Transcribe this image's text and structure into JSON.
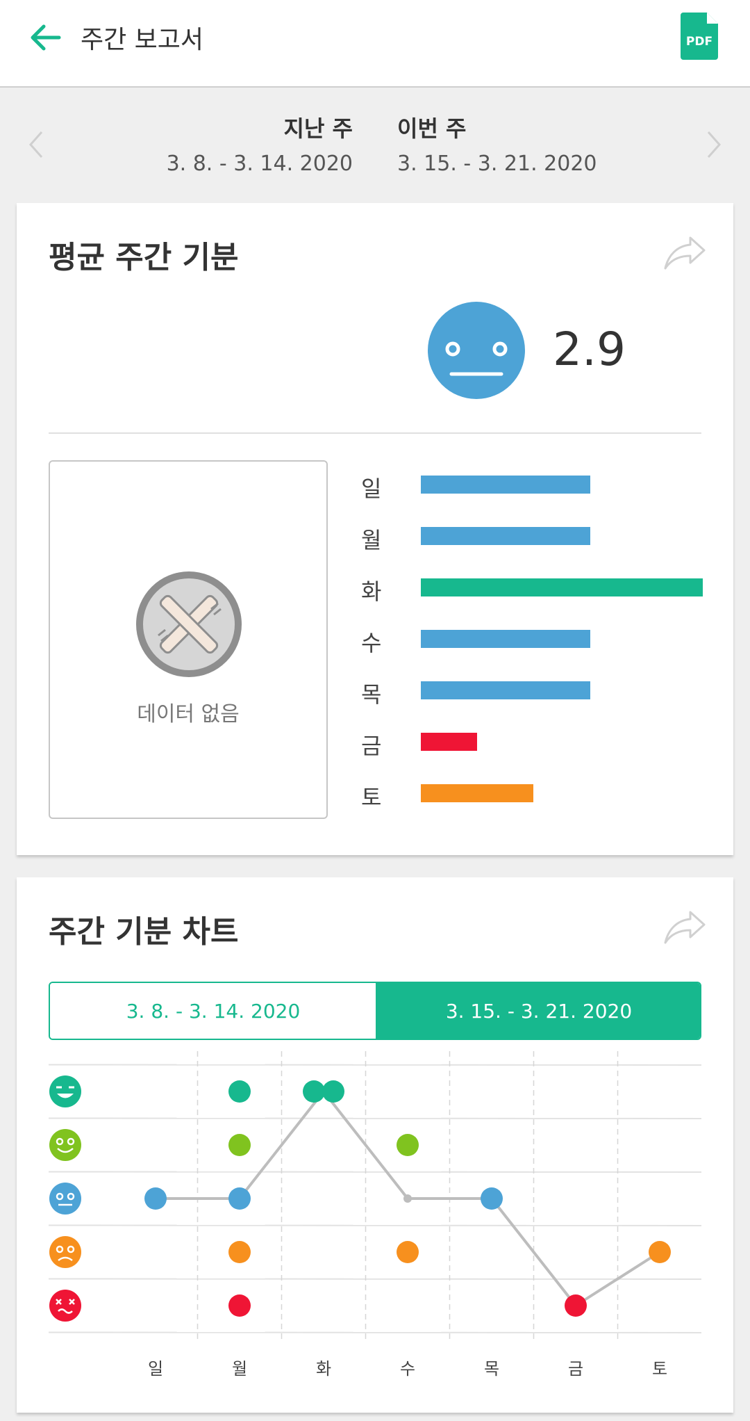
{
  "header": {
    "title": "주간 보고서",
    "pdf_label": "PDF"
  },
  "week_nav": {
    "prev": {
      "label": "지난 주",
      "range": "3. 8. - 3. 14. 2020"
    },
    "current": {
      "label": "이번 주",
      "range": "3. 15. - 3. 21. 2020"
    }
  },
  "avg_card": {
    "title": "평균 주간 기분",
    "score": "2.9",
    "face": "neutral-face-icon",
    "no_data": "데이터 없음",
    "days": [
      {
        "label": "일",
        "fraction": 0.6,
        "color": "#4da3d6"
      },
      {
        "label": "월",
        "fraction": 0.6,
        "color": "#4da3d6"
      },
      {
        "label": "화",
        "fraction": 1.0,
        "color": "#17b88e"
      },
      {
        "label": "수",
        "fraction": 0.6,
        "color": "#4da3d6"
      },
      {
        "label": "목",
        "fraction": 0.6,
        "color": "#4da3d6"
      },
      {
        "label": "금",
        "fraction": 0.2,
        "color": "#ef1535"
      },
      {
        "label": "토",
        "fraction": 0.4,
        "color": "#f7901e"
      }
    ]
  },
  "chart_card": {
    "title": "주간 기분 차트",
    "toggle": {
      "prev": "3. 8. - 3. 14. 2020",
      "current": "3. 15. - 3. 21. 2020",
      "selected": "current"
    }
  },
  "chart_data": {
    "type": "scatter",
    "categories": [
      "일",
      "월",
      "화",
      "수",
      "목",
      "금",
      "토"
    ],
    "y_levels": [
      {
        "level": 5,
        "icon": "laughing-face-icon",
        "color": "#17b88e"
      },
      {
        "level": 4,
        "icon": "happy-face-icon",
        "color": "#80c31f"
      },
      {
        "level": 3,
        "icon": "neutral-face-icon",
        "color": "#4da3d6"
      },
      {
        "level": 2,
        "icon": "sad-face-icon",
        "color": "#f7901e"
      },
      {
        "level": 1,
        "icon": "dizzy-face-icon",
        "color": "#ef1535"
      }
    ],
    "ylim": [
      1,
      5
    ],
    "grid": true,
    "line_color": "#bdbdbd",
    "points": [
      {
        "day": 0,
        "level": 3
      },
      {
        "day": 1,
        "level": 5
      },
      {
        "day": 1,
        "level": 4
      },
      {
        "day": 1,
        "level": 3
      },
      {
        "day": 1,
        "level": 2
      },
      {
        "day": 1,
        "level": 1
      },
      {
        "day": 2,
        "level": 5
      },
      {
        "day": 3,
        "level": 4
      },
      {
        "day": 3,
        "level": 2
      },
      {
        "day": 4,
        "level": 3
      },
      {
        "day": 5,
        "level": 1
      },
      {
        "day": 6,
        "level": 2
      }
    ],
    "line": [
      {
        "day": 0,
        "level": 3
      },
      {
        "day": 1,
        "level": 3
      },
      {
        "day": 2,
        "level": 5
      },
      {
        "day": 3,
        "level": 3
      },
      {
        "day": 4,
        "level": 3
      },
      {
        "day": 5,
        "level": 1
      },
      {
        "day": 6,
        "level": 2
      }
    ]
  }
}
